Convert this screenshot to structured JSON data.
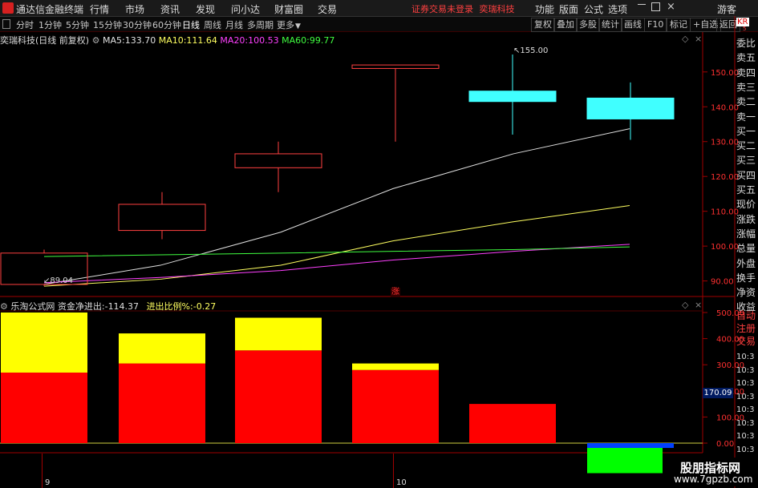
{
  "app": {
    "title": "通达信金融终端",
    "menu": [
      "行情",
      "市场",
      "资讯",
      "发现",
      "问小达",
      "财富圈",
      "交易"
    ],
    "notice_status": "证券交易未登录",
    "notice_stock": "奕瑞科技",
    "right_menu": [
      "功能",
      "版面",
      "公式",
      "选项"
    ],
    "user": "游客"
  },
  "periods": [
    "分时",
    "1分钟",
    "5分钟",
    "15分钟",
    "30分钟",
    "60分钟",
    "日线",
    "周线",
    "月线",
    "多周期",
    "更多"
  ],
  "active_period": "日线",
  "toolbar": [
    "复权",
    "叠加",
    "多股",
    "统计",
    "画线",
    "F10",
    "标记",
    "+自选",
    "返回"
  ],
  "right_panel": {
    "code_prefix": "KR",
    "code_sub": "5",
    "labels": [
      "委比",
      "卖五",
      "卖四",
      "卖三",
      "卖二",
      "卖一",
      "买一",
      "买二",
      "买三",
      "买四",
      "买五",
      "现价",
      "涨跌",
      "涨幅",
      "总量",
      "外盘",
      "换手",
      "净资",
      "收益"
    ],
    "sub_labels": [
      "自动",
      "注册",
      "交易"
    ],
    "times": [
      "10:3",
      "10:3",
      "10:3",
      "10:3",
      "10:3",
      "10:3",
      "10:3",
      "10:3",
      "10:3",
      "10:3"
    ]
  },
  "main_chart": {
    "stock": "奕瑞科技",
    "mode": "(日线 前复权)",
    "ma": [
      {
        "label": "MA5:",
        "value": "133.70",
        "color": "#e0e0e0"
      },
      {
        "label": "MA10:",
        "value": "111.64",
        "color": "#ffff60"
      },
      {
        "label": "MA20:",
        "value": "100.53",
        "color": "#ff40ff"
      },
      {
        "label": "MA60:",
        "value": "99.77",
        "color": "#40ff40"
      }
    ],
    "high_label": "155.00",
    "low_label": "89.04",
    "zhang": "涨",
    "ylim": [
      86,
      158
    ],
    "yticks": [
      "150.00",
      "140.00",
      "130.00",
      "120.00",
      "110.00",
      "100.00",
      "90.00"
    ]
  },
  "chart_data": [
    {
      "type": "candlestick",
      "title": "奕瑞科技 (日线 前复权)",
      "x": [
        1,
        2,
        3,
        4,
        5,
        6
      ],
      "candles": [
        {
          "open": 89,
          "close": 98,
          "high": 99,
          "low": 88.5,
          "dir": "up"
        },
        {
          "open": 104.5,
          "close": 112,
          "high": 115.5,
          "low": 102,
          "dir": "up"
        },
        {
          "open": 122.5,
          "close": 126.5,
          "high": 130,
          "low": 115.5,
          "dir": "up"
        },
        {
          "open": 151,
          "close": 152,
          "high": 152,
          "low": 130,
          "dir": "up"
        },
        {
          "open": 144.5,
          "close": 141.5,
          "high": 155,
          "low": 132,
          "dir": "down"
        },
        {
          "open": 142.5,
          "close": 136.5,
          "high": 147,
          "low": 130.5,
          "dir": "down"
        }
      ],
      "series": [
        {
          "name": "MA5",
          "color": "#e0e0e0",
          "values": [
            89.04,
            94.5,
            104,
            116.5,
            126.5,
            133.7
          ]
        },
        {
          "name": "MA10",
          "color": "#ffff60",
          "values": [
            88.5,
            90.5,
            94.5,
            101.5,
            107,
            111.64
          ]
        },
        {
          "name": "MA20",
          "color": "#ff40ff",
          "values": [
            89.5,
            91,
            93,
            96,
            98.5,
            100.53
          ]
        },
        {
          "name": "MA60",
          "color": "#40ff40",
          "values": [
            97,
            97.5,
            98,
            98.5,
            99,
            99.77
          ]
        }
      ],
      "ylim": [
        86,
        158
      ]
    },
    {
      "type": "bar",
      "title": "乐淘公式网",
      "x": [
        1,
        2,
        3,
        4,
        5,
        6
      ],
      "series": [
        {
          "name": "red",
          "color": "#ff0000",
          "values": [
            270,
            305,
            355,
            280,
            150,
            0
          ]
        },
        {
          "name": "yellow",
          "color": "#ffff00",
          "values": [
            230,
            115,
            125,
            25,
            0,
            0
          ]
        },
        {
          "name": "green",
          "color": "#00ff00",
          "values": [
            0,
            0,
            0,
            0,
            0,
            -115
          ]
        },
        {
          "name": "blue",
          "color": "#0040ff",
          "values": [
            0,
            0,
            0,
            0,
            0,
            -15
          ]
        }
      ],
      "ylim": [
        -120,
        520
      ]
    }
  ],
  "sub_chart": {
    "title": "乐淘公式网",
    "net_label": "资金净进出:",
    "net_value": "-114.37",
    "ratio_label": "进出比例%:",
    "ratio_value": "-0.27",
    "yticks": [
      "500.00",
      "400.00",
      "300.00",
      "200.00",
      "100.00",
      "0.00"
    ],
    "current_value": "170.09"
  },
  "xaxis": {
    "labels": [
      "9",
      "10"
    ]
  },
  "watermark": {
    "line1": "股朋指标网",
    "line2": "www.7gpzb.com"
  }
}
